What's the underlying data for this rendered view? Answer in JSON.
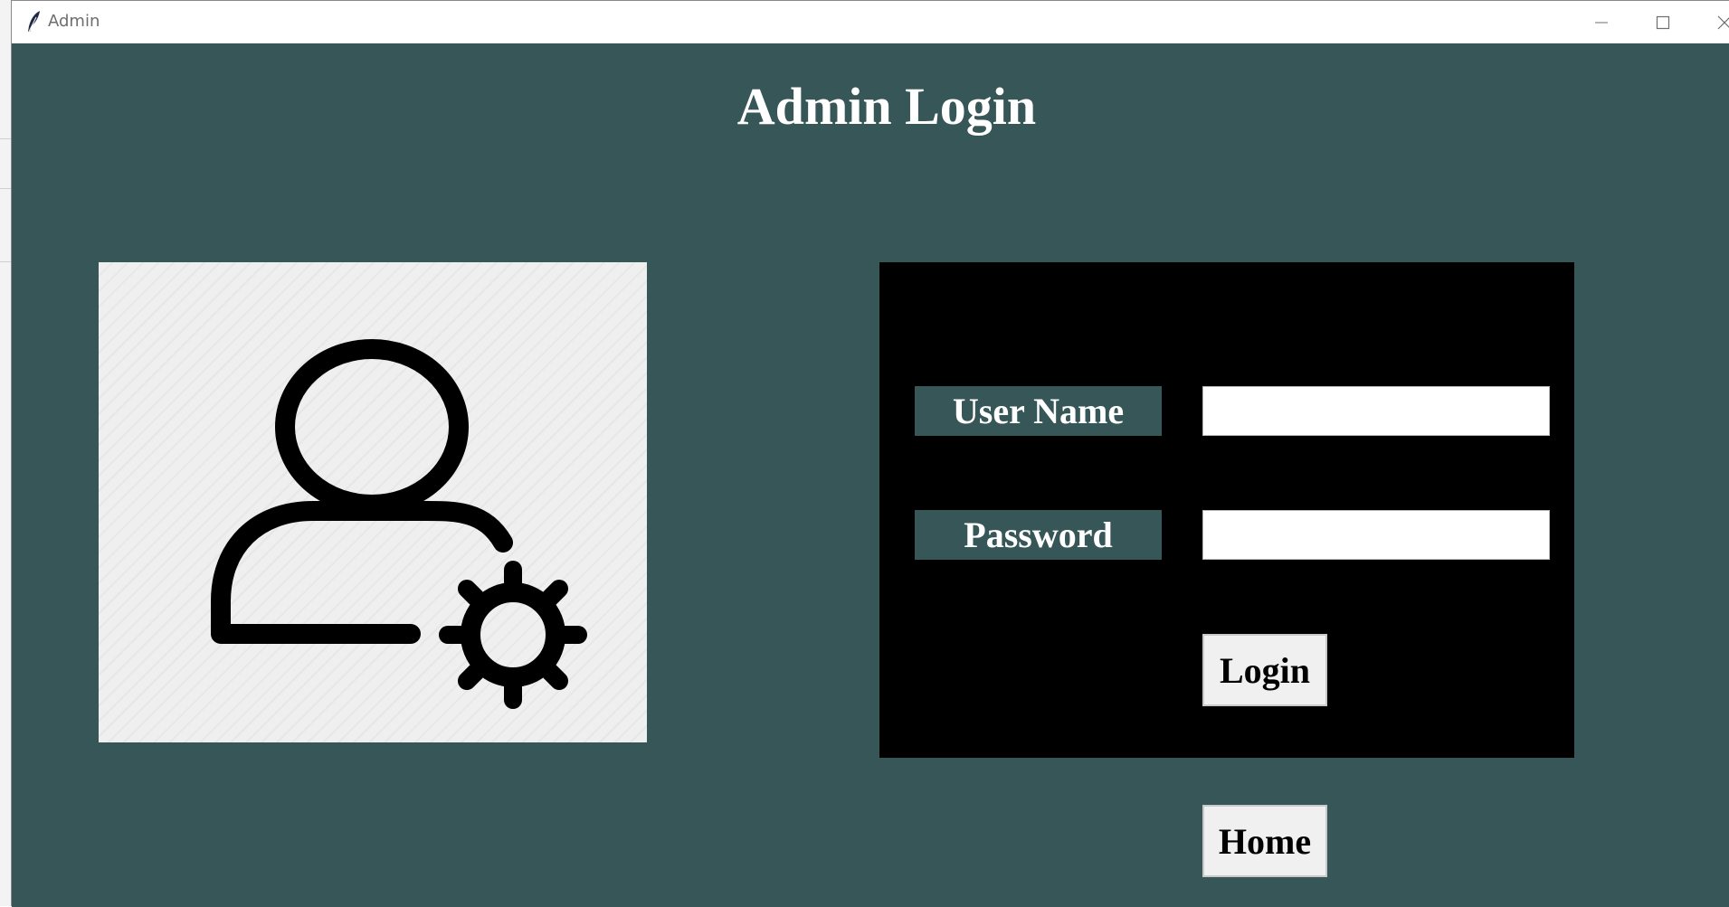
{
  "window": {
    "title": "Admin",
    "icon": "feather-icon",
    "controls": [
      "minimize-icon",
      "maximize-icon",
      "close-icon"
    ]
  },
  "page": {
    "heading": "Admin Login"
  },
  "illustration": {
    "icon": "user-settings-icon"
  },
  "form": {
    "username_label": "User Name",
    "username_value": "",
    "password_label": "Password",
    "password_value": "",
    "login_label": "Login"
  },
  "nav": {
    "home_label": "Home"
  },
  "colors": {
    "background": "#365657",
    "panel": "#000000",
    "label_bg": "#365657",
    "button_bg": "#f0f0f0",
    "icon_bg": "#efefef"
  }
}
